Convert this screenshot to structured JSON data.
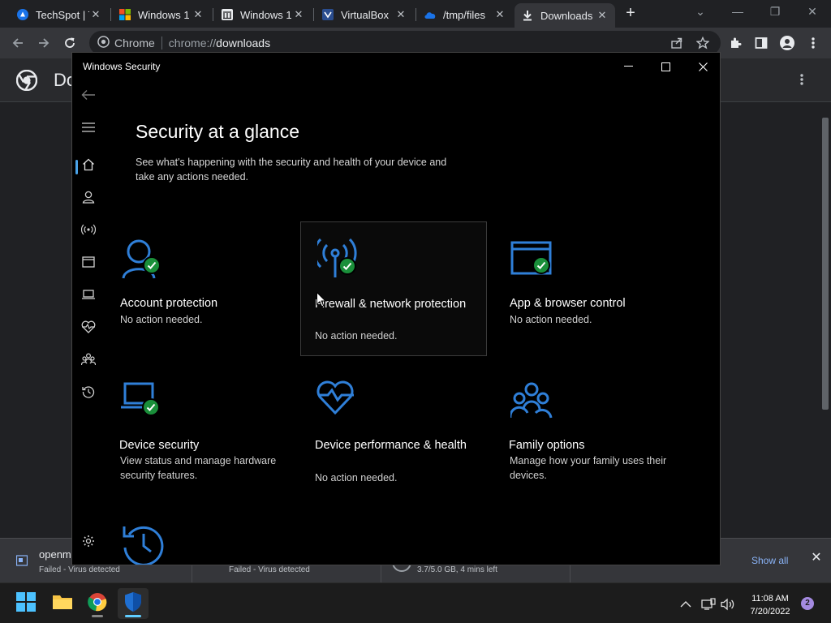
{
  "browser": {
    "tabs": [
      {
        "title": "TechSpot | T",
        "icon": "techspot-icon"
      },
      {
        "title": "Windows 1",
        "icon": "microsoft-icon"
      },
      {
        "title": "Windows 1",
        "icon": "wikipedia-icon"
      },
      {
        "title": "VirtualBox",
        "icon": "virtualbox-icon"
      },
      {
        "title": "/tmp/files",
        "icon": "cloud-icon"
      },
      {
        "title": "Downloads",
        "icon": "download-icon",
        "active": true
      }
    ],
    "site_chip": "Chrome",
    "url_scheme": "chrome://",
    "url_host": "downloads",
    "page_title": "Do"
  },
  "download_bar": {
    "items": [
      {
        "name": "openm",
        "status": "Failed - Virus detected"
      },
      {
        "name": "",
        "status": "Failed - Virus detected"
      },
      {
        "name": "",
        "status": "3.7/5.0 GB, 4 mins left"
      }
    ],
    "show_all": "Show all"
  },
  "taskbar": {
    "time": "11:08 AM",
    "date": "7/20/2022",
    "notifications": "2"
  },
  "security_app": {
    "window_title": "Windows Security",
    "heading": "Security at a glance",
    "subtitle": "See what's happening with the security and health of your device and take any actions needed.",
    "tiles": [
      {
        "title": "Account protection",
        "desc": "No action needed."
      },
      {
        "title": "Firewall & network protection",
        "desc": "No action needed."
      },
      {
        "title": "App & browser control",
        "desc": "No action needed."
      },
      {
        "title": "Device security",
        "desc": "View status and manage hardware security features."
      },
      {
        "title": "Device performance & health",
        "desc": "No action needed."
      },
      {
        "title": "Family options",
        "desc": "Manage how your family uses their devices."
      }
    ]
  },
  "colors": {
    "accent_blue": "#2f7fd8",
    "check_green": "#1a8f3a",
    "chrome_link": "#8ab4f8"
  }
}
